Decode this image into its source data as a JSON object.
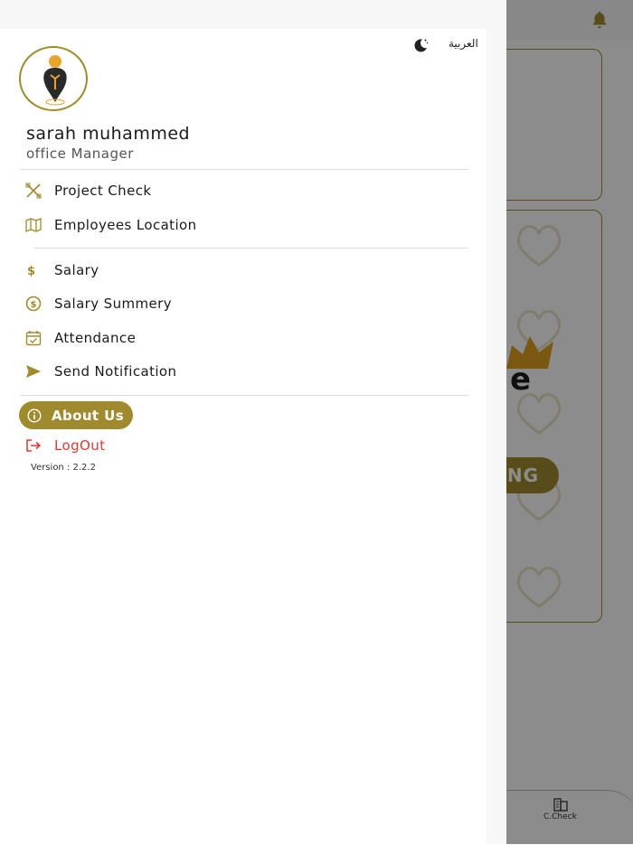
{
  "colors": {
    "accent": "#a08a2e",
    "logout": "#d83a34",
    "overlay": "rgba(0,0,0,0.45)"
  },
  "drawer": {
    "language_toggle": "العربية",
    "theme_icon": "moon-icon",
    "user": {
      "name": "sarah muhammed",
      "role": "office Manager"
    },
    "menu_group_1": [
      {
        "label": "Project Check",
        "icon": "tools-icon"
      },
      {
        "label": "Employees Location",
        "icon": "map-icon"
      }
    ],
    "menu_group_2": [
      {
        "label": "Salary",
        "icon": "dollar-icon"
      },
      {
        "label": "Salary Summery",
        "icon": "dollar-circle-icon"
      },
      {
        "label": "Attendance",
        "icon": "calendar-check-icon"
      },
      {
        "label": "Send Notification",
        "icon": "send-icon"
      }
    ],
    "about_label": "About Us",
    "logout_label": "LogOut",
    "version": "Version : 2.2.2"
  },
  "background": {
    "bottom_nav_label": "C.Check",
    "pill_text": "NG",
    "logo_letter": "e"
  }
}
